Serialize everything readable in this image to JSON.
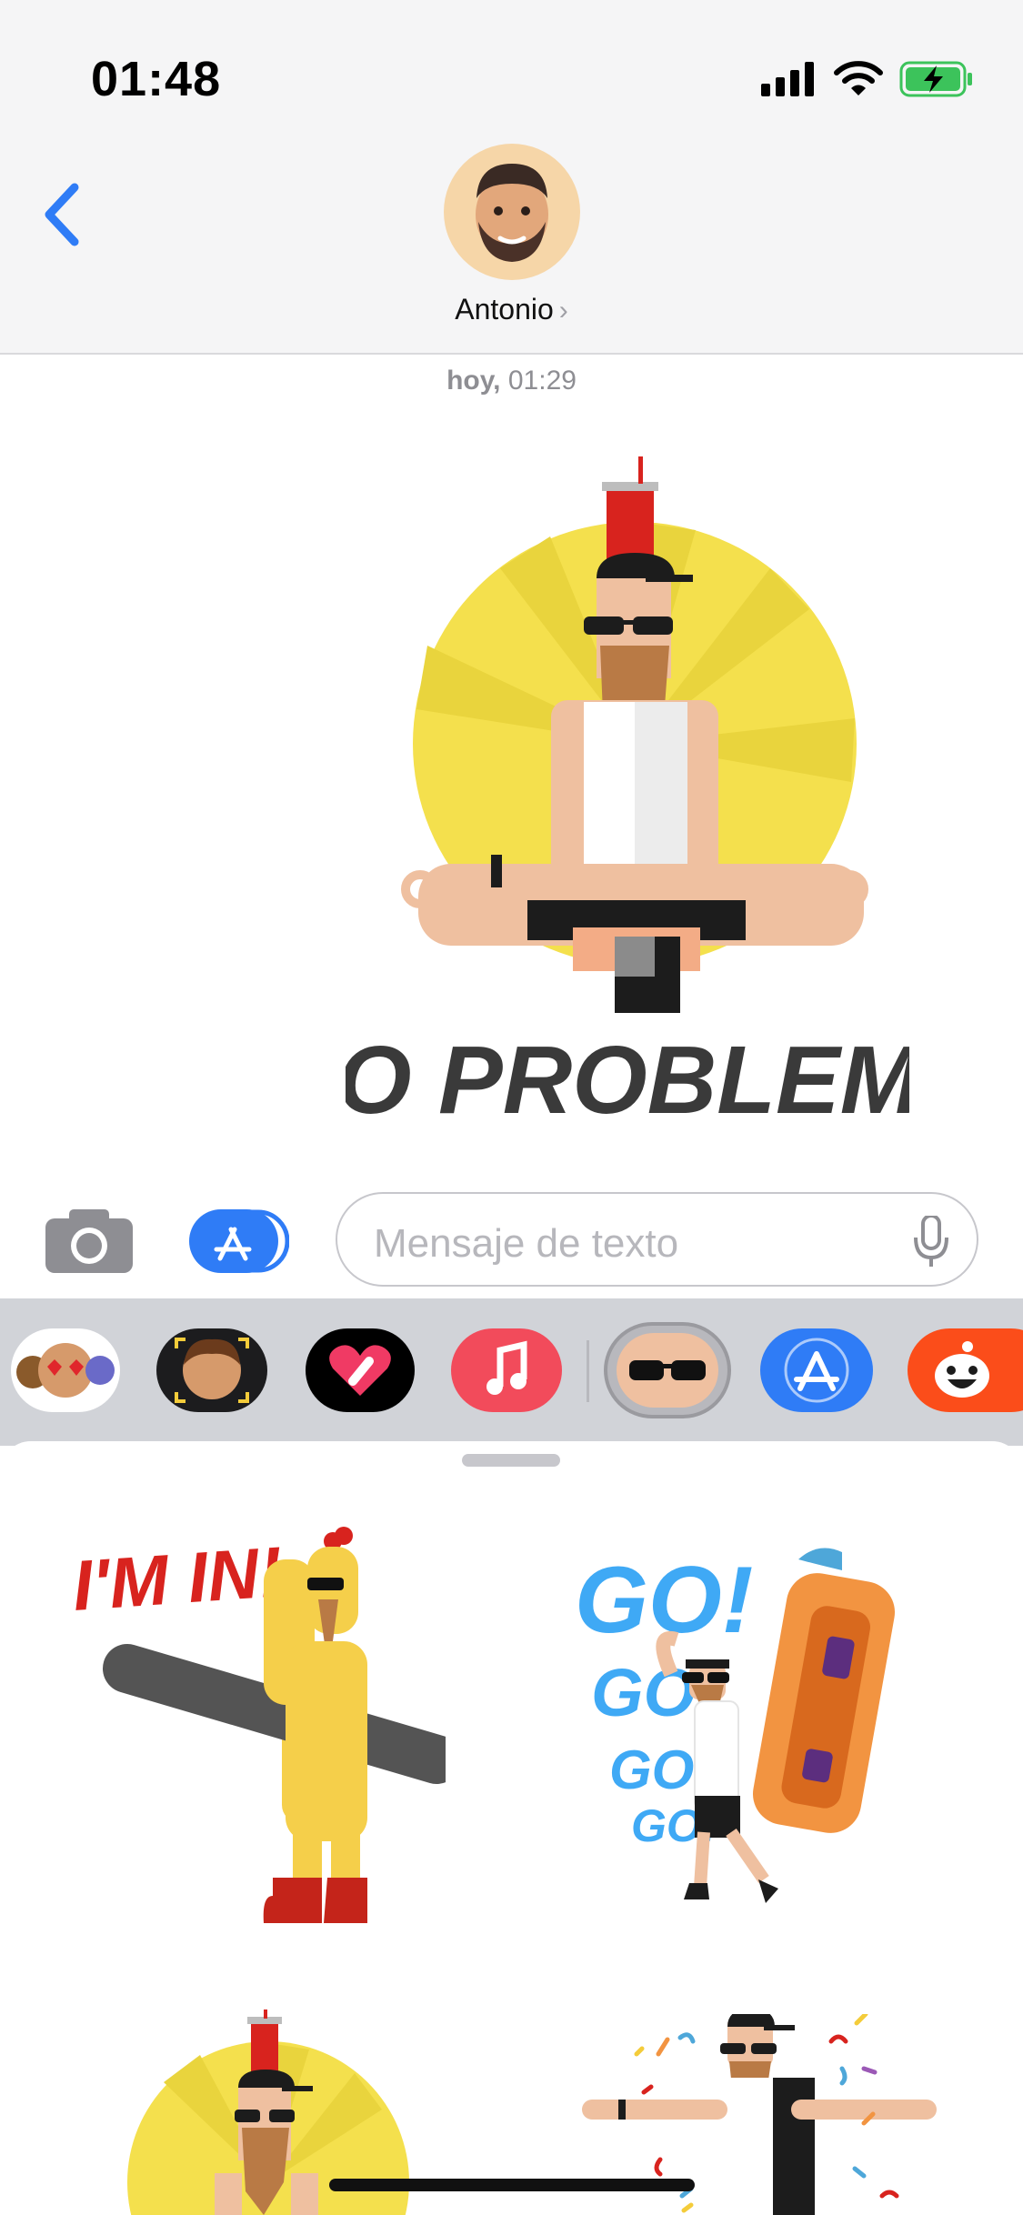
{
  "status_bar": {
    "time": "01:48",
    "icons": [
      "signal-icon",
      "wifi-icon",
      "battery-charging-icon"
    ]
  },
  "header": {
    "back_icon": "chevron-left-icon",
    "contact_name": "Antonio",
    "contact_chevron": "›"
  },
  "conversation": {
    "timestamp_day": "hoy,",
    "timestamp_time": "01:29",
    "sticker": {
      "caption": "NO PROBLEMO"
    }
  },
  "input_bar": {
    "camera_icon": "camera-icon",
    "apps_icon": "app-store-icon",
    "placeholder": "Mensaje de texto",
    "mic_icon": "microphone-icon"
  },
  "app_drawer": {
    "apps": [
      "memoji-stickers",
      "animoji",
      "digital-touch",
      "music",
      "sticker-pack-selected",
      "app-store",
      "reddit-emoji"
    ]
  },
  "sticker_panel": {
    "stickers": [
      {
        "caption": "I'M IN!"
      },
      {
        "caption_lines": [
          "GO!",
          "GO!",
          "GO!",
          "GO!"
        ]
      },
      {
        "caption": ""
      },
      {
        "caption": ""
      }
    ]
  },
  "colors": {
    "accent": "#2f7cf6",
    "sticker_yellow": "#f4e04d",
    "sticker_red": "#d8231e",
    "text_blue": "#3fa9f5",
    "sofa_orange": "#f29441"
  }
}
